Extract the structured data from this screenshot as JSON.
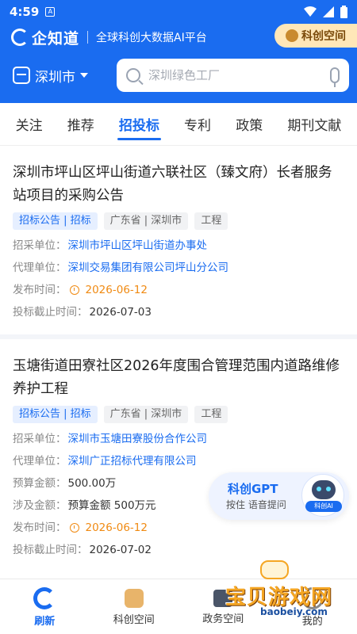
{
  "status_bar": {
    "time": "4:59",
    "a_glyph": "A"
  },
  "header": {
    "brand_name": "企知道",
    "slogan": "全球科创大数据AI平台",
    "kechuang_label": "科创空间",
    "city": "深圳市",
    "search_placeholder": "深圳绿色工厂"
  },
  "tabs": [
    {
      "label": "关注"
    },
    {
      "label": "推荐"
    },
    {
      "label": "招投标",
      "active": true
    },
    {
      "label": "专利"
    },
    {
      "label": "政策"
    },
    {
      "label": "期刊文献"
    }
  ],
  "cards": [
    {
      "title": "深圳市坪山区坪山街道六联社区（臻文府）长者服务站项目的采购公告",
      "tags": [
        "招标公告 | 招标",
        "广东省 | 深圳市",
        "工程"
      ],
      "purchaser_label": "招采单位：",
      "purchaser": "深圳市坪山区坪山街道办事处",
      "agent_label": "代理单位：",
      "agent": "深圳交易集团有限公司坪山分公司",
      "publish_label": "发布时间：",
      "publish_date": "2026-06-12",
      "deadline_label": "投标截止时间：",
      "deadline": "2026-07-03"
    },
    {
      "title": "玉塘街道田寮社区2026年度围合管理范围内道路维修养护工程",
      "tags": [
        "招标公告 | 招标",
        "广东省 | 深圳市",
        "工程"
      ],
      "purchaser_label": "招采单位：",
      "purchaser": "深圳市玉塘田寮股份合作公司",
      "agent_label": "代理单位：",
      "agent": "深圳广正招标代理有限公司",
      "budget_label": "预算金额：",
      "budget": "500.00万",
      "amount_label": "涉及金额：",
      "amount": "预算金额 500万元",
      "publish_label": "发布时间：",
      "publish_date": "2026-06-12",
      "deadline_label": "投标截止时间：",
      "deadline": "2026-07-02"
    }
  ],
  "gpt_float": {
    "title": "科创GPT",
    "subtitle": "按住  语音提问",
    "robot_label": "科创AI"
  },
  "bottom_nav": [
    {
      "label": "刷新",
      "icon": "refresh-icon",
      "active": true
    },
    {
      "label": "科创空间",
      "icon": "space-icon"
    },
    {
      "label": "政务空间",
      "icon": "gov-icon"
    },
    {
      "label": "我的",
      "icon": "profile-icon"
    }
  ],
  "watermark": {
    "text": "宝贝游戏网",
    "url": "baobeiy.com"
  },
  "colors": {
    "brand": "#1a6cf0",
    "accent_orange": "#f08a12",
    "kechuang_bg": "#ffe7b8"
  }
}
